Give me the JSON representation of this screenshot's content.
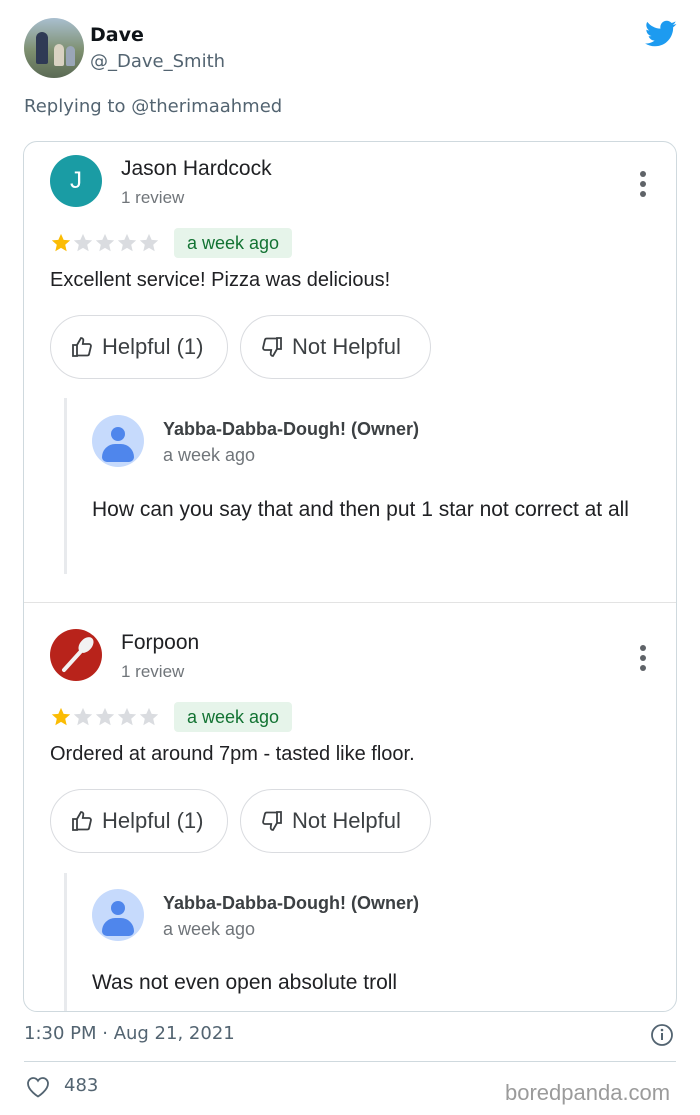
{
  "tweet": {
    "display_name": "Dave",
    "handle": "@_Dave_Smith",
    "replying_prefix": "Replying to",
    "replying_to": "@therimaahmed",
    "timestamp": "1:30 PM · Aug 21, 2021",
    "like_count": "483",
    "brand_color": "#1d9bf0"
  },
  "reviews": [
    {
      "avatar_letter": "J",
      "avatar_color": "#1a9ca4",
      "name": "Jason Hardcock",
      "review_count": "1 review",
      "rating": 1,
      "rating_max": 5,
      "time": "a week ago",
      "text": "Excellent service! Pizza was delicious!",
      "helpful_label": "Helpful (1)",
      "not_helpful_label": "Not Helpful",
      "owner_reply": {
        "name": "Yabba-Dabba-Dough! (Owner)",
        "time": "a week ago",
        "text": "How can you say that and then put 1 star not correct at all"
      }
    },
    {
      "avatar_icon": "fork-icon",
      "avatar_color": "#b8231b",
      "name": "Forpoon",
      "review_count": "1 review",
      "rating": 1,
      "rating_max": 5,
      "time": "a week ago",
      "text": "Ordered at around 7pm - tasted like floor.",
      "helpful_label": "Helpful (1)",
      "not_helpful_label": "Not Helpful",
      "owner_reply": {
        "name": "Yabba-Dabba-Dough! (Owner)",
        "time": "a week ago",
        "text": "Was not even open absolute troll"
      }
    }
  ],
  "colors": {
    "star_filled": "#fbbc04",
    "star_empty": "#dadce0",
    "badge_bg": "#e6f4ea",
    "badge_text": "#137333"
  },
  "watermark": "boredpanda.com"
}
